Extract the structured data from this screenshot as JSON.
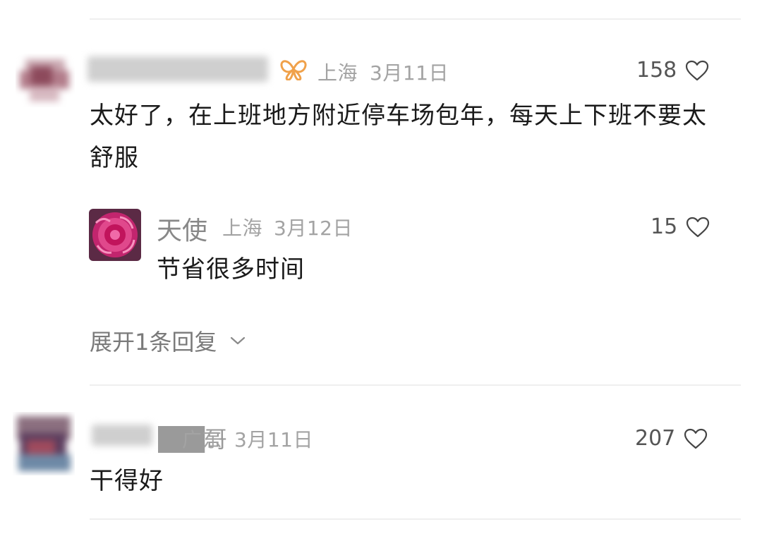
{
  "comments": [
    {
      "user_name": "████████",
      "location": "上海",
      "date": "3月11日",
      "likes": "158",
      "text": "太好了，在上班地方附近停车场包年，每天上下班不要太舒服",
      "badge_icon": "butterfly-badge-icon",
      "reply": {
        "user_name": "天使",
        "location": "上海",
        "date": "3月12日",
        "likes": "15",
        "text": "节省很多时间"
      },
      "expand_label": "展开1条回复"
    },
    {
      "user_name": "███哥",
      "location": "广东",
      "date": "3月11日",
      "likes": "207",
      "text": "干得好"
    }
  ],
  "colors": {
    "badge": "#f0a14a",
    "meta_text": "#a3a3a3",
    "divider": "#efefef"
  }
}
